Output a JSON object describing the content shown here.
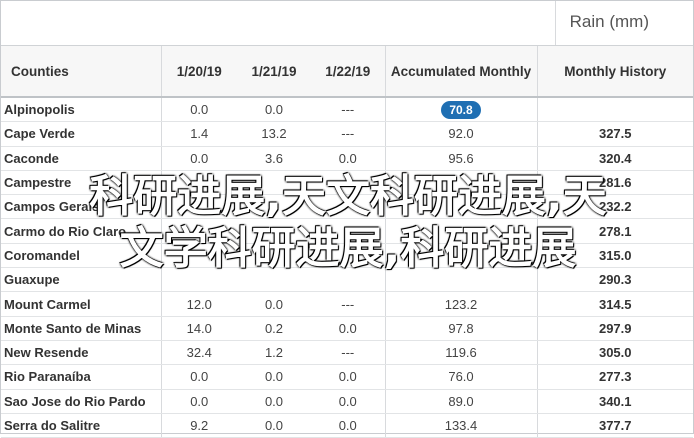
{
  "unit_label": "Rain (mm)",
  "columns": {
    "counties": "Counties",
    "d1": "1/20/19",
    "d2": "1/21/19",
    "d3": "1/22/19",
    "acc": "Accumulated Monthly",
    "hist": "Monthly History"
  },
  "rows": [
    {
      "name": "Alpinopolis",
      "d1": "0.0",
      "d2": "0.0",
      "d3": "---",
      "acc": "70.8",
      "hist": "",
      "highlight": true
    },
    {
      "name": "Cape Verde",
      "d1": "1.4",
      "d2": "13.2",
      "d3": "---",
      "acc": "92.0",
      "hist": "327.5"
    },
    {
      "name": "Caconde",
      "d1": "0.0",
      "d2": "3.6",
      "d3": "0.0",
      "acc": "95.6",
      "hist": "320.4"
    },
    {
      "name": "Campestre",
      "d1": "",
      "d2": "",
      "d3": "",
      "acc": "",
      "hist": "281.6"
    },
    {
      "name": "Campos Gerais",
      "d1": "",
      "d2": "",
      "d3": "",
      "acc": "",
      "hist": "232.2"
    },
    {
      "name": "Carmo do Rio Claro",
      "d1": "",
      "d2": "",
      "d3": "",
      "acc": "",
      "hist": "278.1"
    },
    {
      "name": "Coromandel",
      "d1": "",
      "d2": "",
      "d3": "",
      "acc": "",
      "hist": "315.0"
    },
    {
      "name": "Guaxupe",
      "d1": "",
      "d2": "",
      "d3": "",
      "acc": "",
      "hist": "290.3"
    },
    {
      "name": "Mount Carmel",
      "d1": "12.0",
      "d2": "0.0",
      "d3": "---",
      "acc": "123.2",
      "hist": "314.5"
    },
    {
      "name": "Monte Santo de Minas",
      "d1": "14.0",
      "d2": "0.2",
      "d3": "0.0",
      "acc": "97.8",
      "hist": "297.9"
    },
    {
      "name": "New Resende",
      "d1": "32.4",
      "d2": "1.2",
      "d3": "---",
      "acc": "119.6",
      "hist": "305.0"
    },
    {
      "name": "Rio Paranaíba",
      "d1": "0.0",
      "d2": "0.0",
      "d3": "0.0",
      "acc": "76.0",
      "hist": "277.3"
    },
    {
      "name": "Sao Jose do Rio Pardo",
      "d1": "0.0",
      "d2": "0.0",
      "d3": "0.0",
      "acc": "89.0",
      "hist": "340.1"
    },
    {
      "name": "Serra do Salitre",
      "d1": "9.2",
      "d2": "0.0",
      "d3": "0.0",
      "acc": "133.4",
      "hist": "377.7"
    }
  ],
  "watermark": {
    "line1": "科研进展,天文科研进展,天",
    "line2": "文学科研进展,科研进展"
  }
}
